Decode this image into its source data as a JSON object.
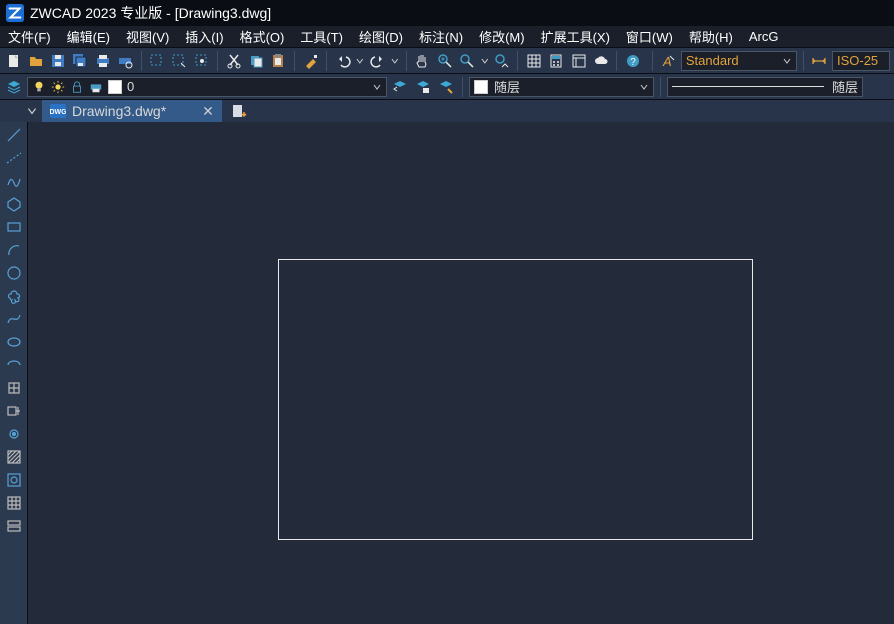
{
  "titlebar": {
    "text": "ZWCAD 2023 专业版 - [Drawing3.dwg]"
  },
  "menu": {
    "items": [
      "文件(F)",
      "编辑(E)",
      "视图(V)",
      "插入(I)",
      "格式(O)",
      "工具(T)",
      "绘图(D)",
      "标注(N)",
      "修改(M)",
      "扩展工具(X)",
      "窗口(W)",
      "帮助(H)",
      "ArcG"
    ]
  },
  "toolbar1": {
    "style_label": "Standard",
    "dim_label": "ISO-25"
  },
  "toolbar2": {
    "layer_label": "0",
    "color_label": "随层",
    "linetype_label": "随层"
  },
  "tab": {
    "filename": "Drawing3.dwg*"
  }
}
